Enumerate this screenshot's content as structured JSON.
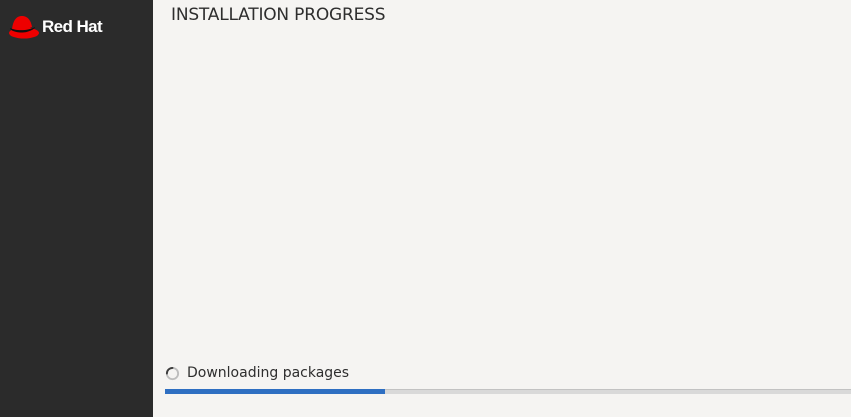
{
  "sidebar": {
    "brand": {
      "name": "Red Hat",
      "logo_icon": "red-hat-logo-icon",
      "hat_color": "#ee0000"
    },
    "background": "#2b2b2b"
  },
  "main": {
    "title": "INSTALLATION PROGRESS",
    "status": {
      "icon": "spinner-icon",
      "text": "Downloading packages"
    },
    "progress": {
      "fraction": 0.32,
      "color": "#2e6fc2"
    }
  }
}
